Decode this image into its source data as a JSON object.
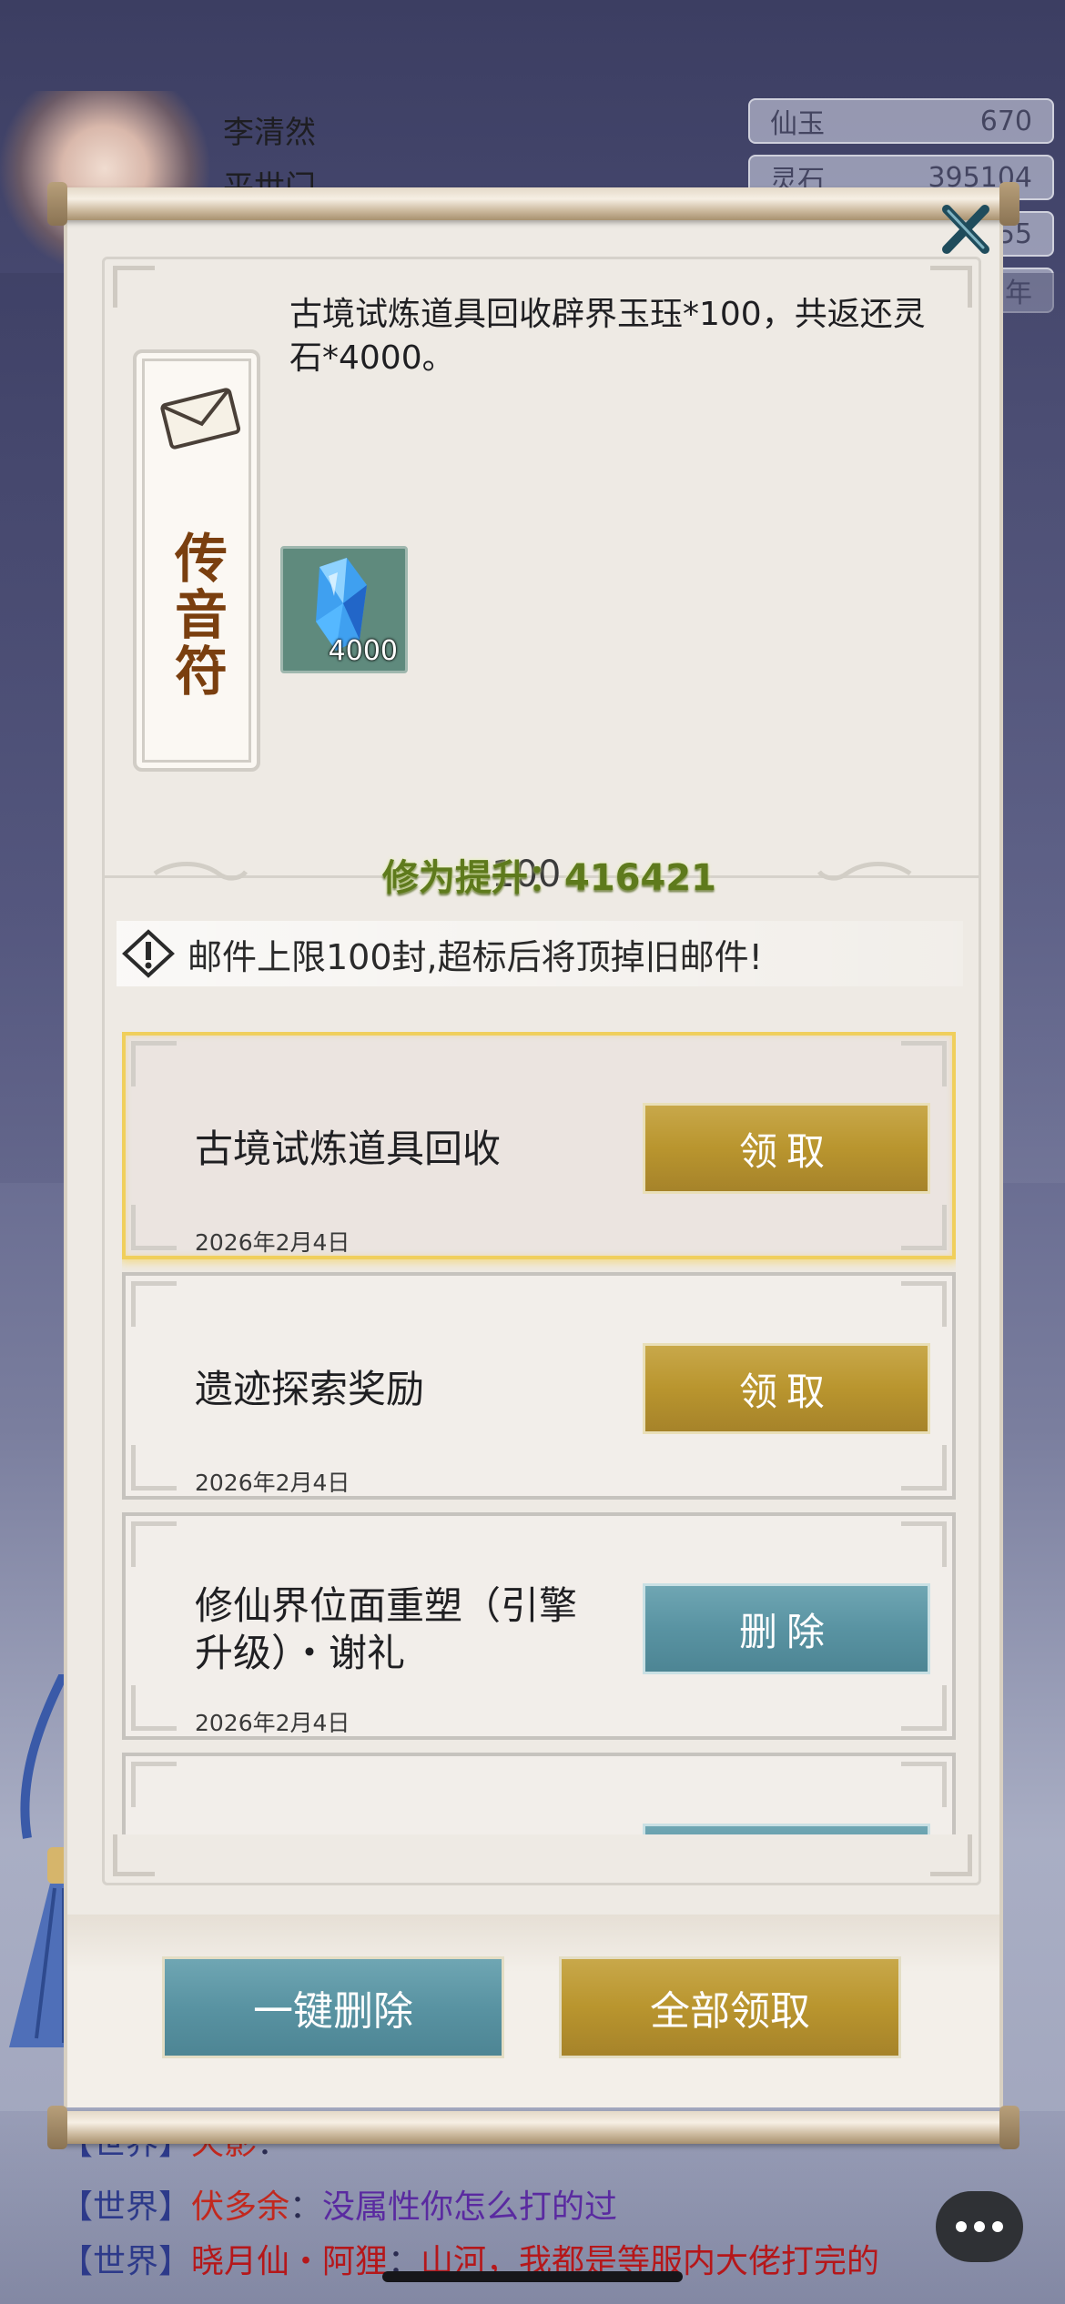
{
  "background": {
    "player_name": "李清然",
    "player_sect": "平世门",
    "resources": [
      {
        "label": "仙玉",
        "value": "670"
      },
      {
        "label": "灵石",
        "value": "395104"
      },
      {
        "label": "",
        "value": "55"
      },
      {
        "label": "",
        "value": "年"
      }
    ],
    "chat": [
      {
        "channel": "【世界】",
        "sender": "天影",
        "sep": "：",
        "message": ""
      },
      {
        "channel": "【世界】",
        "sender": "伏多余",
        "sep": "：",
        "message": "没属性你怎么打的过"
      },
      {
        "channel": "【世界】",
        "sender": "晓月仙・阿狸",
        "sep": "：",
        "message": "山河，我都是等服内大佬打完的"
      }
    ]
  },
  "dialog": {
    "close_icon": "close-x-icon",
    "talisman_label": "传音符",
    "letter_body": "古境试炼道具回收辟界玉珏*100，共返还灵石*4000。",
    "reward": {
      "icon": "spirit-stone-icon",
      "quantity": "4000"
    },
    "floating_text": "修为提升：416421",
    "floating_text_behind": "100",
    "warning_text": "邮件上限100封,超标后将顶掉旧邮件!",
    "mails": [
      {
        "title": "古境试炼道具回收",
        "date": "2026年2月4日",
        "action": "领取",
        "action_type": "claim",
        "selected": true
      },
      {
        "title": "遗迹探索奖励",
        "date": "2026年2月4日",
        "action": "领取",
        "action_type": "claim",
        "selected": false
      },
      {
        "title": "修仙界位面重塑（引擎升级）・谢礼",
        "date": "2026年2月4日",
        "action": "删除",
        "action_type": "delete",
        "selected": false
      },
      {
        "title": "",
        "date": "",
        "action": "",
        "action_type": "delete",
        "selected": false
      }
    ],
    "footer": {
      "delete_all": "一键删除",
      "claim_all": "全部领取"
    }
  },
  "colors": {
    "gold_button": "#b9952e",
    "teal_button": "#5993a2",
    "selected_glow": "#f0cf5c",
    "talisman_text": "#7a3f0f"
  }
}
